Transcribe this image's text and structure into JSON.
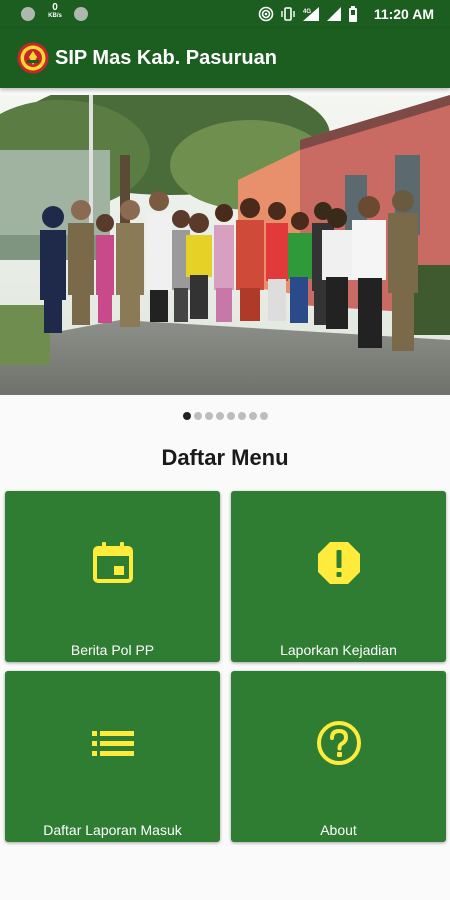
{
  "status_bar": {
    "network_speed": "0",
    "network_unit": "KB/s",
    "network_type": "4G",
    "time": "11:20 AM"
  },
  "app_bar": {
    "title": "SIP Mas Kab. Pasuruan",
    "logo_icon": "pasuruan-regency-emblem"
  },
  "banner": {
    "image": "group-photo-outdoor",
    "carousel_count": 8,
    "carousel_active_index": 0
  },
  "menu": {
    "title": "Daftar Menu",
    "items": [
      {
        "label": "Berita Pol PP",
        "icon": "calendar-icon"
      },
      {
        "label": "Laporkan Kejadian",
        "icon": "alert-octagon-icon"
      },
      {
        "label": "Daftar Laporan Masuk",
        "icon": "list-icon"
      },
      {
        "label": "About",
        "icon": "help-circle-icon"
      }
    ]
  },
  "colors": {
    "status_bar": "#1b5e20",
    "app_bar": "#1b5e20",
    "tile": "#2e7d32",
    "icon_accent": "#ffeb3b",
    "background": "#fafafa"
  }
}
